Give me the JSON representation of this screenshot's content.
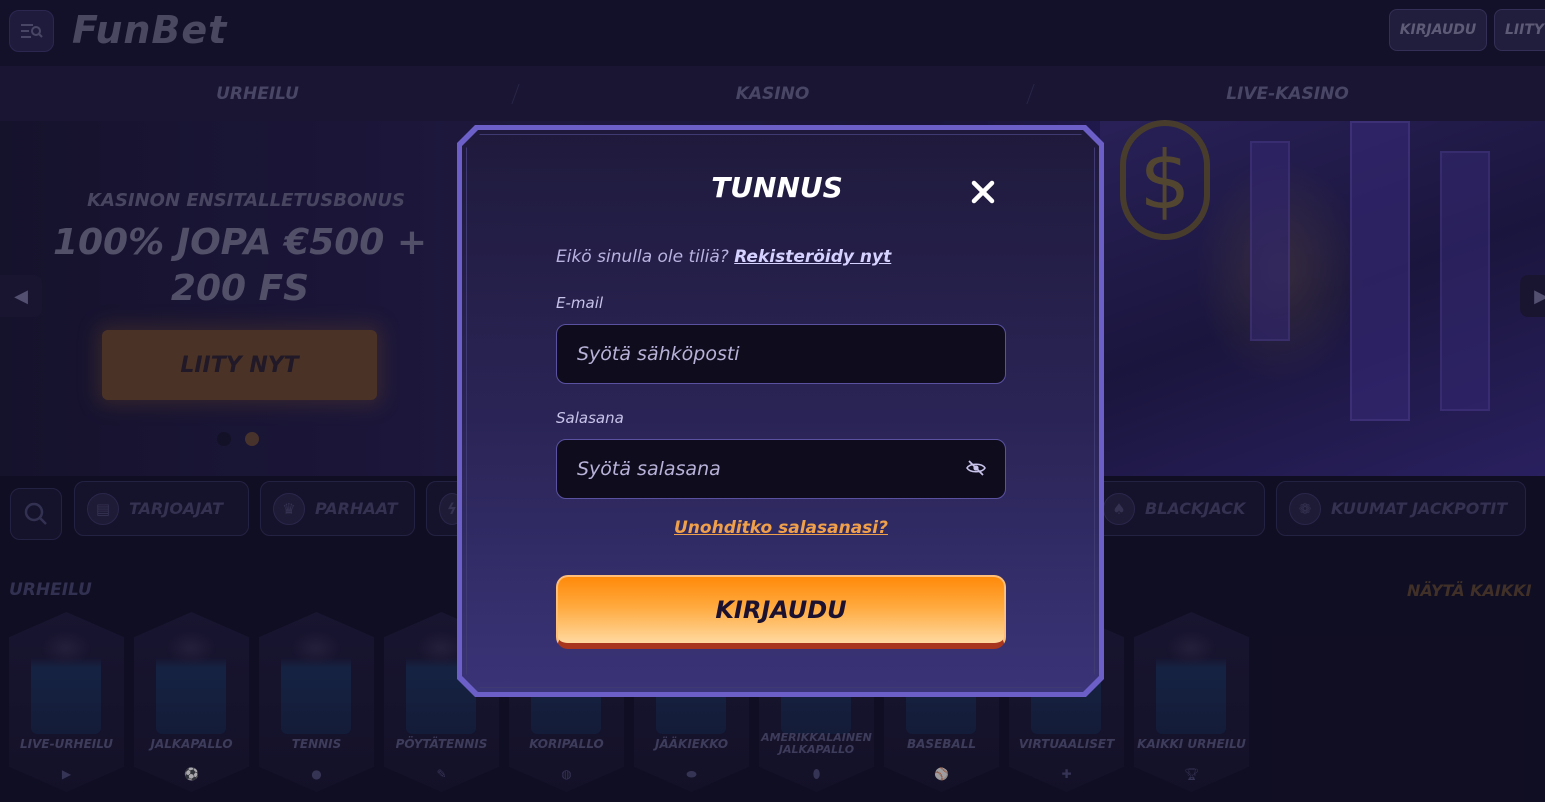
{
  "header": {
    "logo": "FunBet",
    "login_label": "KIRJAUDU",
    "join_label": "LIITY"
  },
  "nav": {
    "items": [
      "URHEILU",
      "KASINO",
      "LIVE-KASINO"
    ]
  },
  "hero": {
    "subtitle": "KASINON ENSITALLETUSBONUS",
    "title_line1": "100% JOPA €500 +",
    "title_line2": "200 FS",
    "cta_label": "LIITY NYT"
  },
  "categories": {
    "items": [
      {
        "label": "TARJOAJAT",
        "icon": "book-icon"
      },
      {
        "label": "PARHAAT",
        "icon": "crown-icon"
      },
      {
        "label": "",
        "icon": "flash-icon"
      },
      {
        "label": "BLACKJACK",
        "icon": "spade-icon"
      },
      {
        "label": "KUUMAT JACKPOTIT",
        "icon": "jackpot-icon"
      }
    ]
  },
  "sports": {
    "title": "URHEILU",
    "show_all": "NÄYTÄ KAIKKI",
    "items": [
      {
        "label": "LIVE-URHEILU",
        "icon": "play-icon"
      },
      {
        "label": "JALKAPALLO",
        "icon": "football-icon"
      },
      {
        "label": "TENNIS",
        "icon": "tennis-ball-icon"
      },
      {
        "label": "PÖYTÄTENNIS",
        "icon": "table-tennis-icon"
      },
      {
        "label": "KORIPALLO",
        "icon": "basketball-icon"
      },
      {
        "label": "JÄÄKIEKKO",
        "icon": "puck-icon"
      },
      {
        "label": "AMERIKKALAINEN JALKAPALLO",
        "icon": "american-football-icon"
      },
      {
        "label": "BASEBALL",
        "icon": "baseball-icon"
      },
      {
        "label": "VIRTUAALISET",
        "icon": "gamepad-icon"
      },
      {
        "label": "KAIKKI URHEILU",
        "icon": "trophy-icon"
      }
    ]
  },
  "modal": {
    "title": "TUNNUS",
    "register_prompt": "Eikö sinulla ole tiliä?",
    "register_link": "Rekisteröidy nyt",
    "email_label": "E-mail",
    "email_placeholder": "Syötä sähköposti",
    "password_label": "Salasana",
    "password_placeholder": "Syötä salasana",
    "forgot_label": "Unohditko salasanasi?",
    "submit_label": "KIRJAUDU"
  },
  "colors": {
    "accent_orange": "#ff9a2a",
    "modal_border": "#6d5fc8",
    "link_orange": "#f0a04a"
  }
}
